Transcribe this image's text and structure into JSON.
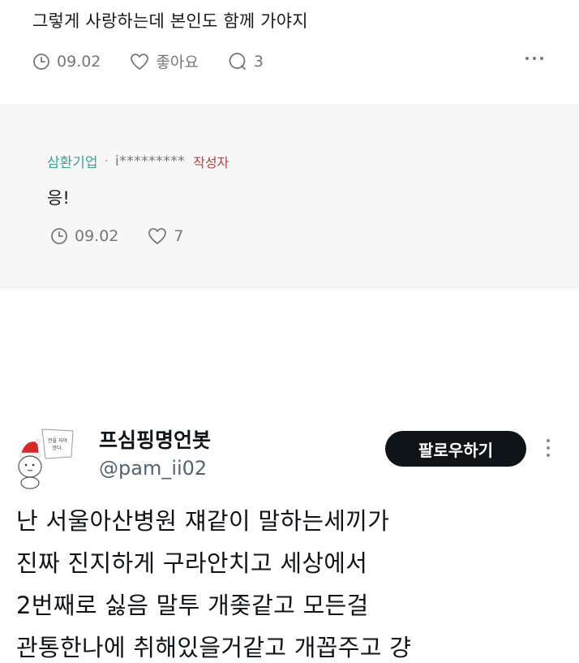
{
  "top_comment": {
    "text": "그렇게 사랑하는데 본인도 함께 가야지",
    "date": "09.02",
    "like_label": "좋아요",
    "comment_count": "3"
  },
  "reply": {
    "company": "삼환기업",
    "separator": "·",
    "username": "i*********",
    "author_badge": "작성자",
    "text": "응!",
    "date": "09.02",
    "likes": "7"
  },
  "tweet": {
    "display_name": "프심핑명언봇",
    "handle": "@pam_ii02",
    "follow_label": "팔로우하기",
    "avatar_caption_1": "전을 자야",
    "avatar_caption_2": "한다.",
    "lines": [
      "난 서울아산병원 쟤같이 말하는세끼가",
      "진짜 진지하게 구라안치고 세상에서",
      "2번째로 싫음 말투 개좆같고 모든걸",
      "관통한나에 취해있을거같고 개꼽주고 걍"
    ]
  },
  "colors": {
    "company": "#3aa39a",
    "author_badge": "#b04444",
    "follow_button": "#0f1419",
    "reply_bg": "#f7f7f7"
  }
}
